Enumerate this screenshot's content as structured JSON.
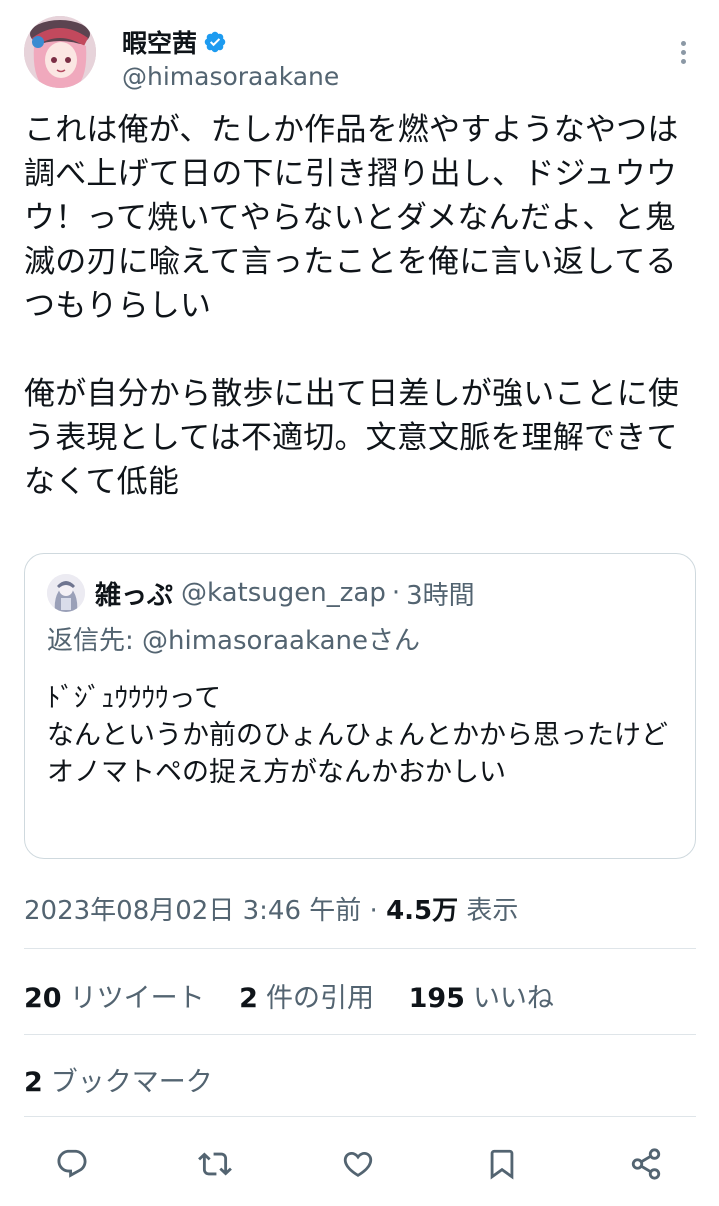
{
  "author": {
    "display_name": "暇空茜",
    "handle": "@himasoraakane",
    "verified": true,
    "verified_color": "#1d9bf0"
  },
  "tweet": {
    "text": "これは俺が、たしか作品を燃やすようなやつは調べ上げて日の下に引き摺り出し、ドジュウウウ！って焼いてやらないとダメなんだよ、と鬼滅の刃に喩えて言ったことを俺に言い返してるつもりらしい\n\n俺が自分から散歩に出て日差しが強いことに使う表現としては不適切。文意文脈を理解できてなくて低能"
  },
  "quote": {
    "display_name": "雑っぷ",
    "handle": "@katsugen_zap",
    "separator": "·",
    "time": "3時間",
    "reply_to": "返信先: @himasoraakaneさん",
    "text": "ﾄﾞｼﾞｭｳｳｳｳって\nなんというか前のひょんひょんとかから思ったけど\nオノマトペの捉え方がなんかおかしい"
  },
  "meta": {
    "timestamp": "2023年08月02日 3:46 午前",
    "separator": "·",
    "views_count": "4.5万",
    "views_label": "表示"
  },
  "stats": {
    "retweets_count": "20",
    "retweets_label": "リツイート",
    "quotes_count": "2",
    "quotes_label": "件の引用",
    "likes_count": "195",
    "likes_label": "いいね",
    "bookmarks_count": "2",
    "bookmarks_label": "ブックマーク"
  },
  "actions": [
    "reply-icon",
    "retweet-icon",
    "like-icon",
    "bookmark-icon",
    "share-icon"
  ],
  "colors": {
    "text_primary": "#0f1419",
    "text_secondary": "#536471",
    "border": "#cfd9de",
    "icon": "#536471"
  }
}
